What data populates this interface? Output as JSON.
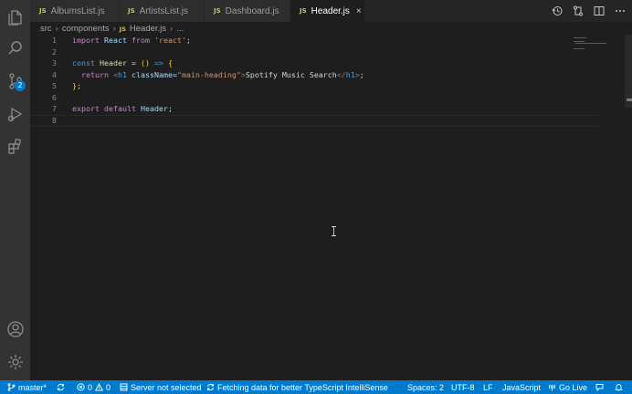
{
  "tabs": [
    {
      "icon": "JS",
      "label": "AlbumsList.js",
      "active": false
    },
    {
      "icon": "JS",
      "label": "ArtistsList.js",
      "active": false
    },
    {
      "icon": "JS",
      "label": "Dashboard.js",
      "active": false
    },
    {
      "icon": "JS",
      "label": "Header.js",
      "active": true,
      "close": "×"
    }
  ],
  "breadcrumb": [
    "src",
    "components",
    "Header.js",
    "..."
  ],
  "breadcrumb_icon": "JS",
  "activity": {
    "scm_badge": "2"
  },
  "editor": {
    "lines": [
      {
        "n": "1",
        "tokens": [
          [
            "kw",
            "import"
          ],
          [
            "plain",
            " "
          ],
          [
            "var",
            "React"
          ],
          [
            "plain",
            " "
          ],
          [
            "kw",
            "from"
          ],
          [
            "plain",
            " "
          ],
          [
            "str",
            "'react'"
          ],
          [
            "plain",
            ";"
          ]
        ]
      },
      {
        "n": "2",
        "tokens": []
      },
      {
        "n": "3",
        "tokens": [
          [
            "kw2",
            "const"
          ],
          [
            "plain",
            " "
          ],
          [
            "fn",
            "Header"
          ],
          [
            "plain",
            " = "
          ],
          [
            "yel",
            "()"
          ],
          [
            "plain",
            " "
          ],
          [
            "kw2",
            "=>"
          ],
          [
            "plain",
            " "
          ],
          [
            "yel",
            "{"
          ]
        ]
      },
      {
        "n": "4",
        "tokens": [
          [
            "plain",
            "  "
          ],
          [
            "kw",
            "return"
          ],
          [
            "plain",
            " "
          ],
          [
            "punc",
            "<"
          ],
          [
            "tag",
            "h1"
          ],
          [
            "plain",
            " "
          ],
          [
            "var",
            "className"
          ],
          [
            "plain",
            "="
          ],
          [
            "str",
            "\"main-heading\""
          ],
          [
            "punc",
            ">"
          ],
          [
            "plain",
            "Spotify Music Search"
          ],
          [
            "punc",
            "</"
          ],
          [
            "tag",
            "h1"
          ],
          [
            "punc",
            ">"
          ],
          [
            "plain",
            ";"
          ]
        ]
      },
      {
        "n": "5",
        "tokens": [
          [
            "yel",
            "}"
          ],
          [
            "plain",
            ";"
          ]
        ]
      },
      {
        "n": "6",
        "tokens": []
      },
      {
        "n": "7",
        "tokens": [
          [
            "kw",
            "export"
          ],
          [
            "plain",
            " "
          ],
          [
            "kw",
            "default"
          ],
          [
            "plain",
            " "
          ],
          [
            "var",
            "Header"
          ],
          [
            "plain",
            ";"
          ]
        ]
      },
      {
        "n": "8",
        "tokens": []
      }
    ]
  },
  "status": {
    "branch": "master*",
    "errors": "0",
    "warnings": "0",
    "server": "Server not selected",
    "fetching": "Fetching data for better TypeScript IntelliSense",
    "spaces": "Spaces: 2",
    "encoding": "UTF-8",
    "eol": "LF",
    "language": "JavaScript",
    "golive": "Go Live"
  },
  "colors": {
    "statusbar": "#007acc",
    "activity_bar": "#333333",
    "editor_bg": "#1e1e1e",
    "tab_inactive": "#2d2d2d"
  }
}
